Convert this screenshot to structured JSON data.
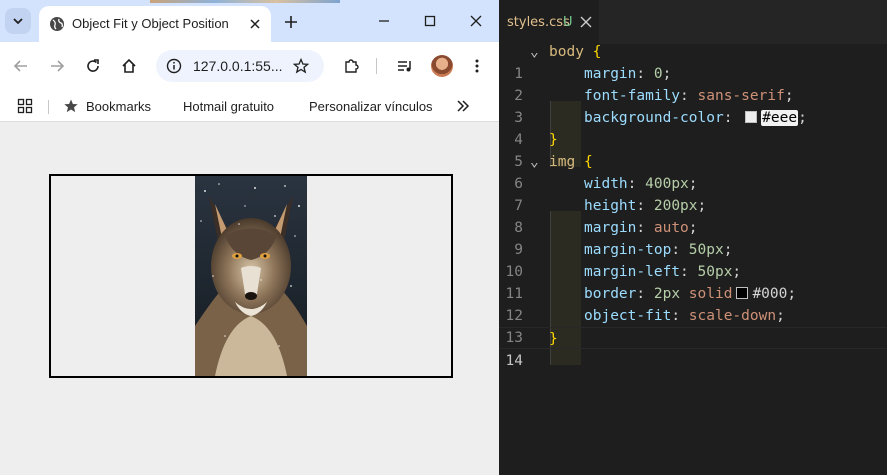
{
  "browser": {
    "tab_title": "Object Fit y Object Position",
    "url": "127.0.0.1:55...",
    "bookmarks": [
      {
        "label": "Bookmarks",
        "icon": "star-icon"
      },
      {
        "label": "Hotmail gratuito",
        "icon": "microsoft-icon"
      },
      {
        "label": "Personalizar vínculos",
        "icon": "microsoft-icon"
      }
    ],
    "colors": {
      "tabstrip": "#d3e3fd",
      "page_background": "#eeeeee",
      "image_border": "#000000"
    }
  },
  "editor": {
    "tab_name": "styles.css",
    "tab_status": "U",
    "lines": [
      {
        "n": "1",
        "selector": "body",
        "brace": "{"
      },
      {
        "n": "2",
        "prop": "margin",
        "value": "0"
      },
      {
        "n": "3",
        "prop": "font-family",
        "value": "sans-serif"
      },
      {
        "n": "4",
        "prop": "background-color",
        "value": "#eee",
        "swatch": "#eeeeee"
      },
      {
        "n": "5",
        "brace": "}"
      },
      {
        "n": "6",
        "selector": "img",
        "brace": "{"
      },
      {
        "n": "7",
        "prop": "width",
        "value": "400px"
      },
      {
        "n": "8",
        "prop": "height",
        "value": "200px"
      },
      {
        "n": "9",
        "prop": "margin",
        "value": "auto"
      },
      {
        "n": "10",
        "prop": "margin-top",
        "value": "50px"
      },
      {
        "n": "11",
        "prop": "margin-left",
        "value": "50px"
      },
      {
        "n": "12",
        "prop": "border",
        "value_num": "2px",
        "value_kw": "solid",
        "value": "#000",
        "swatch": "#000000"
      },
      {
        "n": "13",
        "prop": "object-fit",
        "value": "scale-down"
      },
      {
        "n": "14",
        "brace": "}"
      }
    ],
    "colors": {
      "background": "#1e1e1e",
      "selector": "#d7ba7d",
      "property": "#9cdcfe",
      "number": "#b5cea8",
      "string": "#ce9178",
      "brace": "#ffd700"
    }
  }
}
